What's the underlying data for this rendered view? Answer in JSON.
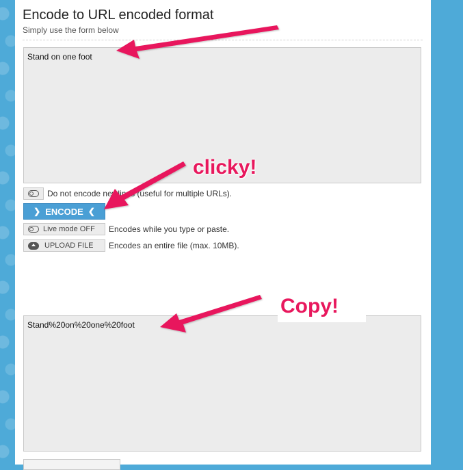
{
  "page": {
    "title": "Encode to URL encoded format",
    "subtitle": "Simply use the form below"
  },
  "input": {
    "value": "Stand on one foot"
  },
  "options": {
    "newline_text": "Do not encode newlines (useful for multiple URLs).",
    "encode_label": "ENCODE",
    "live_mode_label": "Live mode OFF",
    "live_mode_text": "Encodes while you type or paste.",
    "upload_label": "UPLOAD FILE",
    "upload_text": "Encodes an entire file (max. 10MB)."
  },
  "output": {
    "value": "Stand%20on%20one%20foot"
  },
  "annotations": {
    "clicky": "clicky!",
    "copy": "Copy!",
    "arrow_color": "#e8185d"
  },
  "colors": {
    "accent": "#4a9fd5",
    "background": "#4eaad8"
  },
  "icons": [
    "toggle-icon",
    "chevron-right-icon",
    "chevron-left-icon",
    "upload-cloud-icon"
  ]
}
